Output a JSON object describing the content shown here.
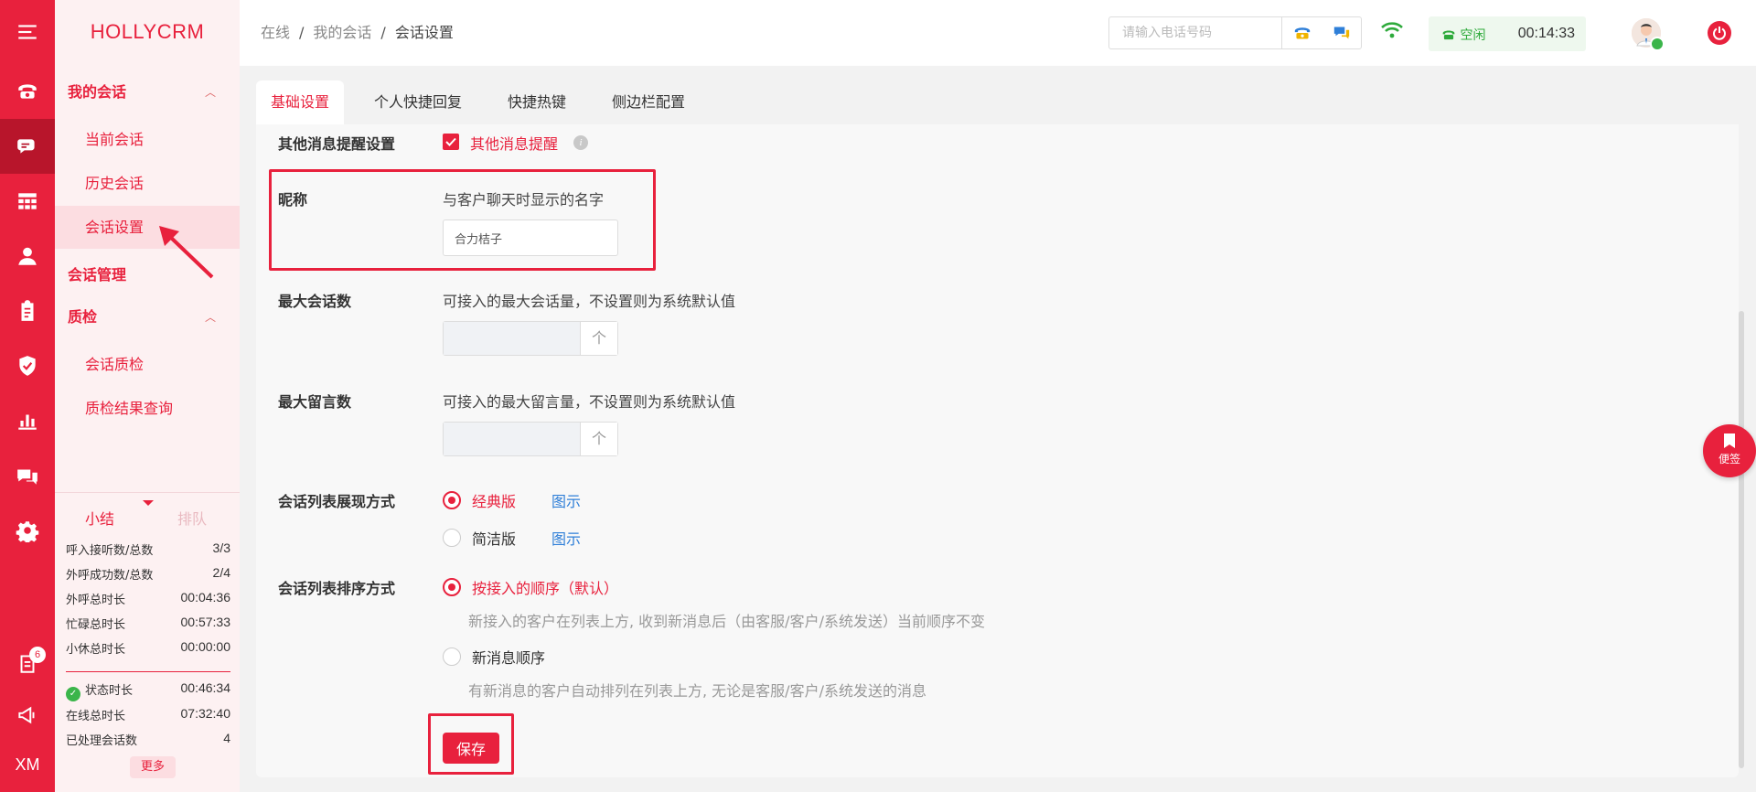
{
  "brand": "HOLLYCRM",
  "rail": {
    "badge_count": "6",
    "bottom_text": "XM",
    "icons": [
      "menu-icon",
      "phone-icon",
      "chat-icon",
      "grid-icon",
      "user-icon",
      "clipboard-icon",
      "shield-icon",
      "bar-chart-icon",
      "messages-icon",
      "settings-icon",
      "notice-icon",
      "megaphone-icon"
    ]
  },
  "nav": {
    "my_sessions": "我的会话",
    "current_session": "当前会话",
    "history_session": "历史会话",
    "session_settings": "会话设置",
    "session_management": "会话管理",
    "quality_check": "质检",
    "session_qc": "会话质检",
    "qc_result_query": "质检结果查询"
  },
  "summary": {
    "tab_summary": "小结",
    "tab_queue": "排队",
    "rows": [
      {
        "label": "呼入接听数/总数",
        "value": "3/3"
      },
      {
        "label": "外呼成功数/总数",
        "value": "2/4"
      },
      {
        "label": "外呼总时长",
        "value": "00:04:36"
      },
      {
        "label": "忙碌总时长",
        "value": "00:57:33"
      },
      {
        "label": "小休总时长",
        "value": "00:00:00"
      },
      {
        "label": "状态时长",
        "value": "00:46:34"
      },
      {
        "label": "在线总时长",
        "value": "07:32:40"
      },
      {
        "label": "已处理会话数",
        "value": "4"
      }
    ],
    "more": "更多"
  },
  "header": {
    "crumb_1": "在线",
    "crumb_2": "我的会话",
    "crumb_3": "会话设置",
    "separator": "/",
    "phone_placeholder": "请输入电话号码",
    "agent_status": "空闲",
    "timer": "00:14:33"
  },
  "tabs": [
    "基础设置",
    "个人快捷回复",
    "快捷热键",
    "侧边栏配置"
  ],
  "settings": {
    "other_msg_label": "其他消息提醒设置",
    "other_msg_checkbox": "其他消息提醒",
    "nickname_label": "昵称",
    "nickname_desc": "与客户聊天时显示的名字",
    "nickname_value": "合力桔子",
    "max_session_label": "最大会话数",
    "max_session_desc": "可接入的最大会话量，不设置则为系统默认值",
    "max_message_label": "最大留言数",
    "max_message_desc": "可接入的最大留言量，不设置则为系统默认值",
    "step_arrow": "个",
    "list_display_label": "会话列表展现方式",
    "classic": "经典版",
    "simple": "简洁版",
    "preview": "图示",
    "list_sort_label": "会话列表排序方式",
    "sort_by_access": "按接入的顺序（默认）",
    "sort_by_access_hint": "新接入的客户在列表上方, 收到新消息后（由客服/客户/系统发送）当前顺序不变",
    "sort_by_new": "新消息顺序",
    "sort_by_new_hint": "有新消息的客户自动排列在列表上方, 无论是客服/客户/系统发送的消息",
    "save": "保存"
  },
  "floating_note": "便签",
  "colors": {
    "brand_red": "#e8213d",
    "nav_bg": "#fdf1f2",
    "online_green": "#2eaa3b",
    "link_blue": "#2f7fd8"
  }
}
